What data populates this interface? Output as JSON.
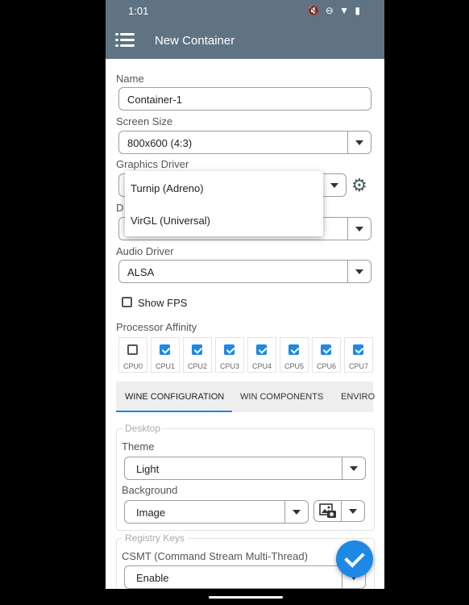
{
  "status": {
    "time": "1:01",
    "icons": "🔇 ⊖ ▼ ▮"
  },
  "appbar": {
    "title": "New Container"
  },
  "form": {
    "name_label": "Name",
    "name_value": "Container-1",
    "screen_size_label": "Screen Size",
    "screen_size_value": "800x600 (4:3)",
    "graphics_driver_label": "Graphics Driver",
    "dx_label_partial": "D",
    "audio_driver_label": "Audio Driver",
    "audio_driver_value": "ALSA",
    "show_fps_label": "Show FPS",
    "show_fps_checked": false,
    "processor_affinity_label": "Processor Affinity",
    "cpus": [
      {
        "label": "CPU0",
        "checked": false
      },
      {
        "label": "CPU1",
        "checked": true
      },
      {
        "label": "CPU2",
        "checked": true
      },
      {
        "label": "CPU3",
        "checked": true
      },
      {
        "label": "CPU4",
        "checked": true
      },
      {
        "label": "CPU5",
        "checked": true
      },
      {
        "label": "CPU6",
        "checked": true
      },
      {
        "label": "CPU7",
        "checked": true
      }
    ]
  },
  "graphics_dropdown": {
    "options": [
      "Turnip (Adreno)",
      "VirGL (Universal)"
    ]
  },
  "tabs": [
    {
      "label": "WINE CONFIGURATION",
      "active": true
    },
    {
      "label": "WIN COMPONENTS",
      "active": false
    },
    {
      "label": "ENVIRO",
      "active": false
    }
  ],
  "desktop": {
    "group_label": "Desktop",
    "theme_label": "Theme",
    "theme_value": "Light",
    "background_label": "Background",
    "background_value": "Image"
  },
  "registry": {
    "group_label": "Registry Keys",
    "csmt_label": "CSMT (Command Stream Multi-Thread)",
    "csmt_value": "Enable"
  },
  "colors": {
    "appbar": "#5f7382",
    "accent": "#1e88e5"
  }
}
